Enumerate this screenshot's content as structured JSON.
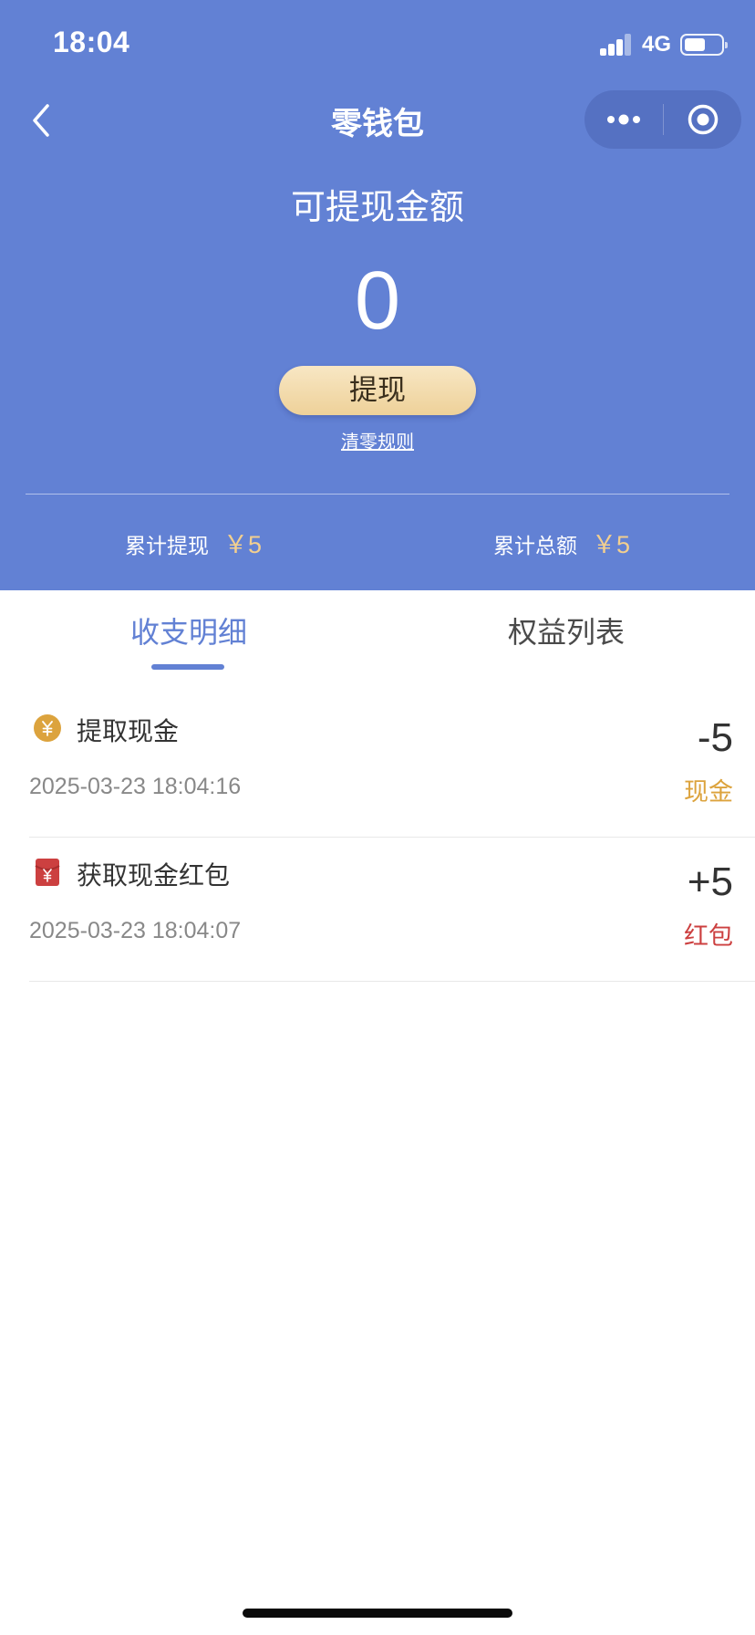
{
  "status_bar": {
    "time": "18:04",
    "network": "4G"
  },
  "nav": {
    "title": "零钱包"
  },
  "balance": {
    "label": "可提现金额",
    "amount": "0",
    "withdraw_button": "提现",
    "rules_link": "清零规则"
  },
  "stats": [
    {
      "label": "累计提现",
      "value": "￥5"
    },
    {
      "label": "累计总额",
      "value": "￥5"
    }
  ],
  "tabs": [
    {
      "label": "收支明细",
      "active": true
    },
    {
      "label": "权益列表",
      "active": false
    }
  ],
  "records": [
    {
      "icon": "coin-yuan-icon",
      "title": "提取现金",
      "time": "2025-03-23 18:04:16",
      "amount": "-5",
      "type": "现金",
      "type_color": "#dca33d"
    },
    {
      "icon": "red-packet-icon",
      "title": "获取现金红包",
      "time": "2025-03-23 18:04:07",
      "amount": "+5",
      "type": "红包",
      "type_color": "#cc4040"
    }
  ],
  "colors": {
    "primary": "#6281d4",
    "gold_text": "#f2cf8f",
    "button_gold": "#eed199"
  }
}
